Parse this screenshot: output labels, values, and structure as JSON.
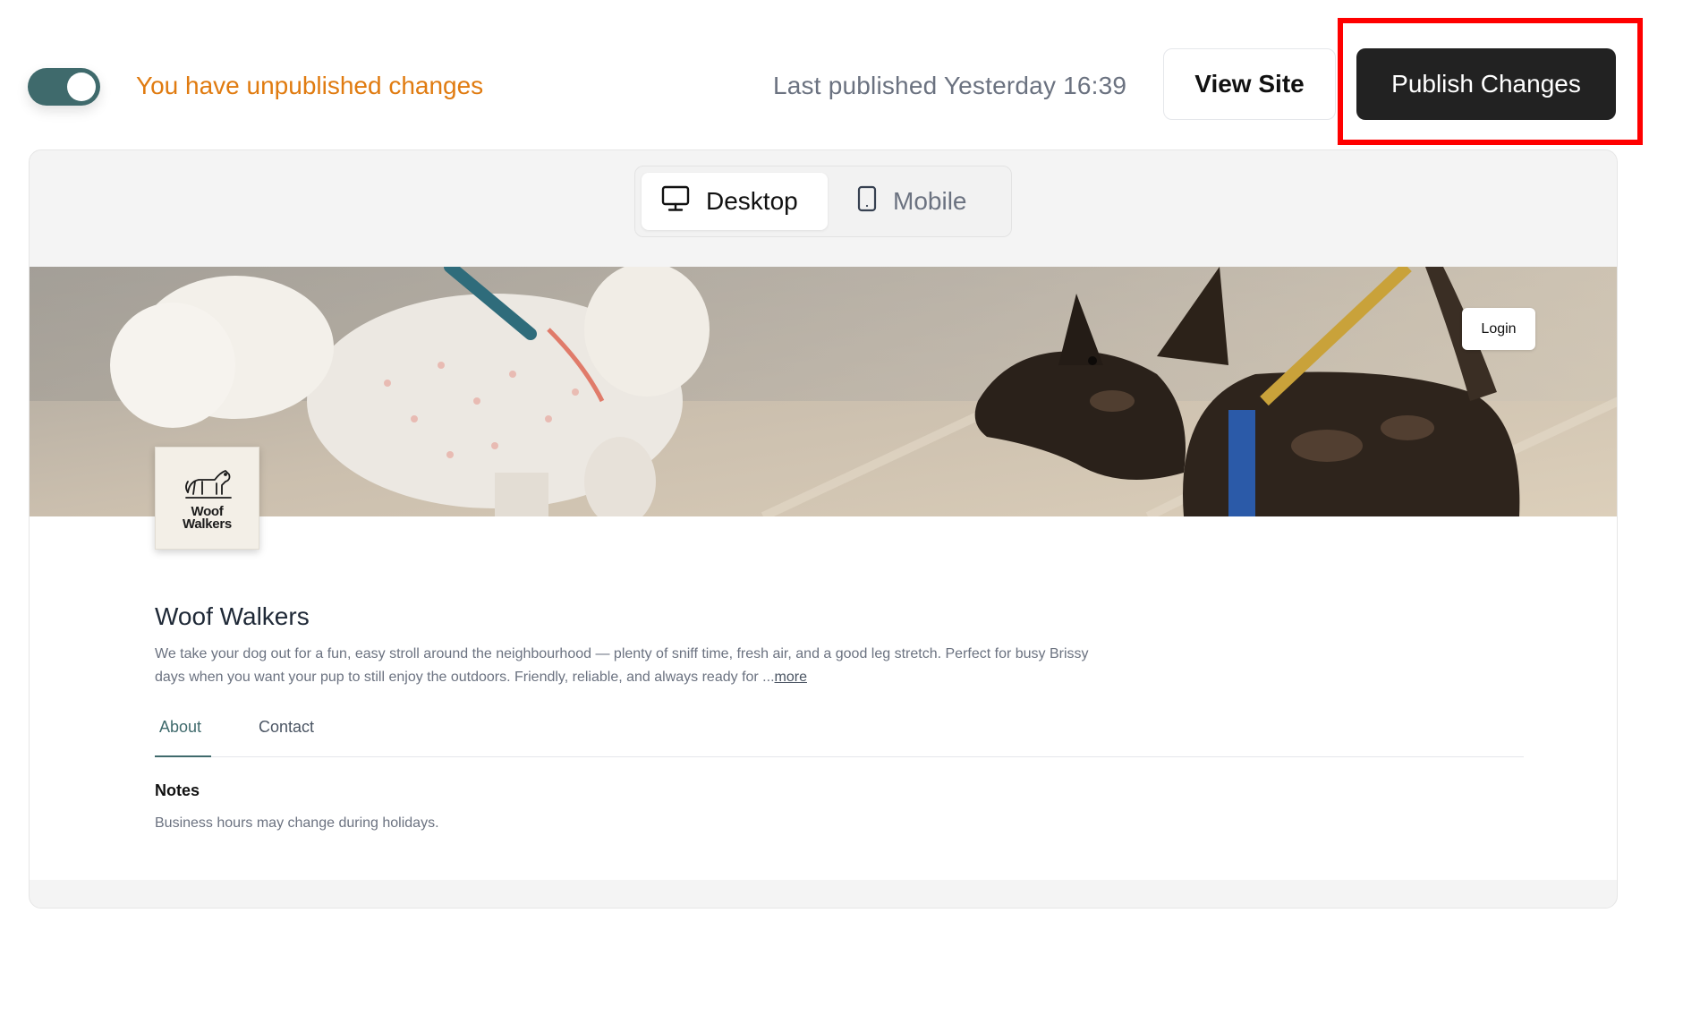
{
  "topbar": {
    "status_text": "You have unpublished changes",
    "last_published": "Last published Yesterday 16:39",
    "view_site_label": "View Site",
    "publish_label": "Publish Changes",
    "toggle_on": true
  },
  "device_switch": {
    "desktop_label": "Desktop",
    "mobile_label": "Mobile",
    "selected": "Desktop"
  },
  "site": {
    "login_label": "Login",
    "logo_text_line1": "Woof",
    "logo_text_line2": "Walkers",
    "name": "Woof Walkers",
    "description": "We take your dog out for a fun, easy stroll around the neighbourhood — plenty of sniff time, fresh air, and a good leg stretch. Perfect for busy Brissy days when you want your pup to still enjoy the outdoors. Friendly, reliable, and always ready for ...",
    "more_label": "more",
    "tabs": [
      {
        "label": "About",
        "active": true
      },
      {
        "label": "Contact",
        "active": false
      }
    ],
    "notes_title": "Notes",
    "notes_text": "Business hours may change during holidays."
  },
  "colors": {
    "accent": "#3f6a6c",
    "warning_text": "#e07b10",
    "publish_bg": "#222222",
    "highlight": "#ff0000"
  }
}
